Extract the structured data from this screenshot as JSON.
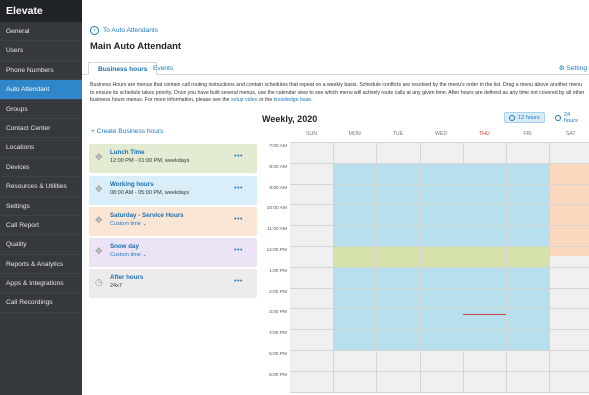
{
  "app": {
    "brand": "Elevate"
  },
  "sidebar": {
    "items": [
      {
        "label": "General"
      },
      {
        "label": "Users"
      },
      {
        "label": "Phone Numbers"
      },
      {
        "label": "Auto Attendant",
        "active": true
      },
      {
        "label": "Groups"
      },
      {
        "label": "Contact Center"
      },
      {
        "label": "Locations"
      },
      {
        "label": "Devices"
      },
      {
        "label": "Resources & Utilities"
      },
      {
        "label": "Settings"
      },
      {
        "label": "Call Report"
      },
      {
        "label": "Quality"
      },
      {
        "label": "Reports & Analytics"
      },
      {
        "label": "Apps & Integrations"
      },
      {
        "label": "Call Recordings"
      }
    ]
  },
  "header": {
    "back_link": "To Auto Attendants",
    "title": "Main Auto Attendant"
  },
  "tabs": [
    {
      "label": "Business hours",
      "active": true
    },
    {
      "label": "Events"
    }
  ],
  "settings_label": "Setting",
  "description": {
    "text": "Business Hours are menus that contain call routing instructions and contain schedules that repeat on a weekly basis. Schedule conflicts are resolved by the menu's order in the list. Drag a menu above another menu to ensure its schedule takes priority. Once you have built several menus, use the calendar view to see which menu will actively route calls at any given time. After hours are defined as any time not covered by all other business hours menus. For more information, please see the ",
    "link1": "setup video",
    "mid": " or the ",
    "link2": "knowledge base",
    "end": "."
  },
  "create_label": "+ Create Business hours",
  "menus": [
    {
      "name": "Lunch Time",
      "sub": "12:00 PM - 01:00 PM, weekdays",
      "bg": "#e3ecd3",
      "icon": "drag-handle-icon"
    },
    {
      "name": "Working hours",
      "sub": "08:00 AM - 05:00 PM, weekdays",
      "bg": "#d9eef8",
      "icon": "drag-handle-icon"
    },
    {
      "name": "Saturday - Service Hours",
      "sub": "Custom time ⌄",
      "bg": "#fbe5d4",
      "icon": "drag-handle-icon"
    },
    {
      "name": "Snow day",
      "sub": "Custom time ⌄",
      "bg": "#ece4f6",
      "icon": "drag-handle-icon"
    },
    {
      "name": "After hours",
      "sub": "24x7",
      "bg": "#ececec",
      "icon": "clock-icon"
    }
  ],
  "calendar": {
    "title": "Weekly, 2020",
    "zoom": [
      {
        "label": "12 hours",
        "active": true
      },
      {
        "label": "24 hours"
      }
    ],
    "days": [
      "SUN",
      "MON",
      "TUE",
      "WED",
      "THU",
      "FRI",
      "SAT"
    ],
    "today": "THU",
    "times": [
      "7:00 AM",
      "8:00 AM",
      "9:00 AM",
      "10:00 AM",
      "11:00 AM",
      "12:00 PM",
      "1:00 PM",
      "2:00 PM",
      "3:00 PM",
      "4:00 PM",
      "5:00 PM",
      "6:00 PM"
    ],
    "colors": {
      "working": "#b7dfee",
      "lunch": "#d5e2a9",
      "saturday": "#fbd7bb",
      "empty": "#f0f0f0"
    }
  }
}
